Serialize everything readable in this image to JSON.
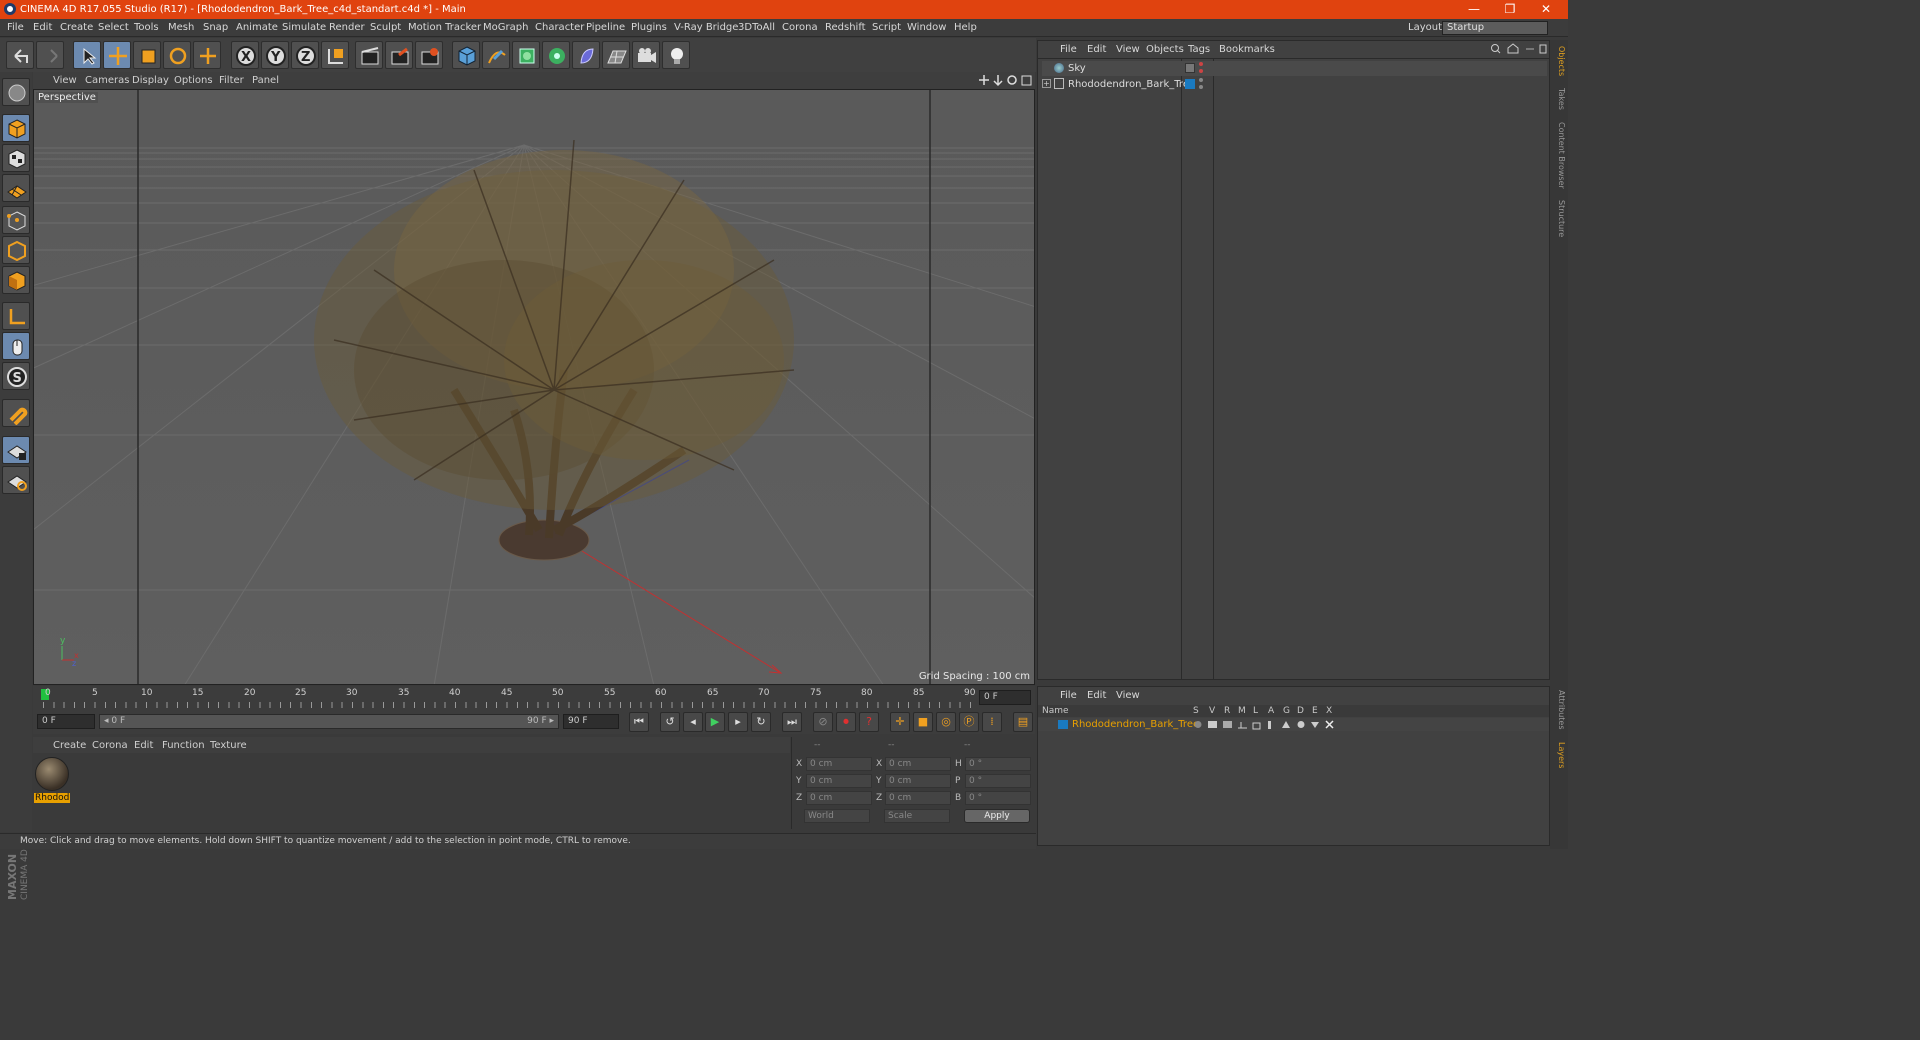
{
  "window": {
    "title": "CINEMA 4D R17.055 Studio (R17) - [Rhododendron_Bark_Tree_c4d_standart.c4d *] - Main",
    "minimize": "—",
    "restore": "❐",
    "close": "✕"
  },
  "menubar": {
    "items": [
      "File",
      "Edit",
      "Create",
      "Select",
      "Tools",
      "Mesh",
      "Snap",
      "Animate",
      "Simulate",
      "Render",
      "Sculpt",
      "Motion Tracker",
      "MoGraph",
      "Character",
      "Pipeline",
      "Plugins",
      "V-Ray Bridge",
      "3DToAll",
      "Corona",
      "Redshift",
      "Script",
      "Window",
      "Help"
    ],
    "layout_label": "Layout:",
    "layout_value": "Startup"
  },
  "toolbar": {
    "axis_x": "X",
    "axis_y": "Y",
    "axis_z": "Z"
  },
  "viewport": {
    "menu": [
      "View",
      "Cameras",
      "Display",
      "Options",
      "Filter",
      "Panel"
    ],
    "label": "Perspective",
    "grid_spacing": "Grid Spacing : 100 cm",
    "axis_y": "y",
    "axis_x": "x",
    "axis_z": "z"
  },
  "timeline": {
    "ticks": [
      "0",
      "5",
      "10",
      "15",
      "20",
      "25",
      "30",
      "35",
      "40",
      "45",
      "50",
      "55",
      "60",
      "65",
      "70",
      "75",
      "80",
      "85",
      "90"
    ],
    "current_frame_box": "0 F",
    "start_field": "0 F",
    "range_start": "◂ 0 F",
    "range_end": "90 F ▸",
    "end_field": "90 F"
  },
  "material": {
    "menu": [
      "Create",
      "Corona",
      "Edit",
      "Function",
      "Texture"
    ],
    "swatch_label": "Rhodod"
  },
  "coordinates": {
    "headers": [
      "--",
      "--",
      "--"
    ],
    "rows": [
      {
        "a": "X",
        "av": "0 cm",
        "b": "X",
        "bv": "0 cm",
        "c": "H",
        "cv": "0 °"
      },
      {
        "a": "Y",
        "av": "0 cm",
        "b": "Y",
        "bv": "0 cm",
        "c": "P",
        "cv": "0 °"
      },
      {
        "a": "Z",
        "av": "0 cm",
        "b": "Z",
        "bv": "0 cm",
        "c": "B",
        "cv": "0 °"
      }
    ],
    "world": "World",
    "scale": "Scale",
    "apply": "Apply"
  },
  "status": "Move: Click and drag to move elements. Hold down SHIFT to quantize movement / add to the selection in point mode, CTRL to remove.",
  "object_manager": {
    "menu": [
      "File",
      "Edit",
      "View",
      "Objects",
      "Tags",
      "Bookmarks"
    ],
    "objects": [
      "Sky",
      "Rhododendron_Bark_Tree"
    ]
  },
  "layer_manager": {
    "menu": [
      "File",
      "Edit",
      "View"
    ],
    "name_header": "Name",
    "columns": [
      "S",
      "V",
      "R",
      "M",
      "L",
      "A",
      "G",
      "D",
      "E",
      "X"
    ],
    "layer_name": "Rhododendron_Bark_Tree"
  },
  "side_tabs": [
    "Objects",
    "Takes",
    "Content Browser",
    "Structure",
    "Attributes",
    "Layers"
  ],
  "colors": {
    "title": "#e0430f",
    "active_tab": "#e0a020",
    "layer": "#e8a000"
  }
}
